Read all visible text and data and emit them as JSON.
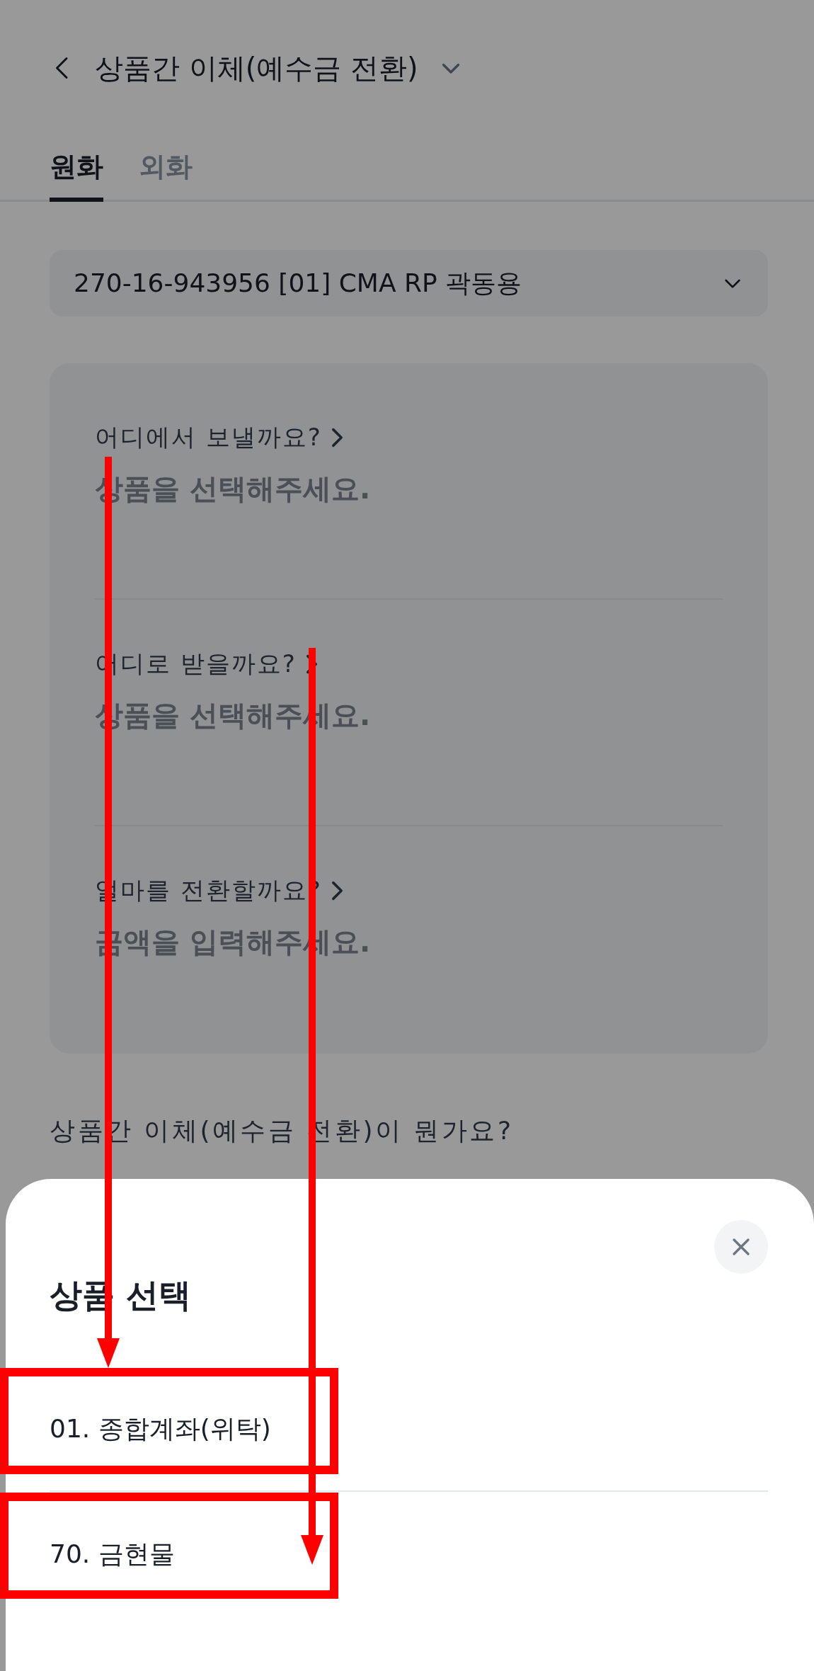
{
  "header": {
    "title": "상품간 이체(예수금 전환)"
  },
  "tabs": [
    {
      "label": "원화",
      "selected": true
    },
    {
      "label": "외화",
      "selected": false
    }
  ],
  "account_select": {
    "value": "270-16-943956 [01] CMA RP 곽동용"
  },
  "transfer_card": {
    "rows": [
      {
        "label": "어디에서 보낼까요?",
        "prompt": "상품을 선택해주세요."
      },
      {
        "label": "어디로 받을까요?",
        "prompt": "상품을 선택해주세요."
      },
      {
        "label": "얼마를 전환할까요?",
        "prompt": "금액을 입력해주세요."
      }
    ]
  },
  "info": {
    "title": "상품간 이체(예수금 전환)이 뭔가요?"
  },
  "sheet": {
    "title": "상품 선택",
    "items": [
      {
        "label": "01. 종합계좌(위탁)"
      },
      {
        "label": "70. 금현물"
      }
    ]
  }
}
